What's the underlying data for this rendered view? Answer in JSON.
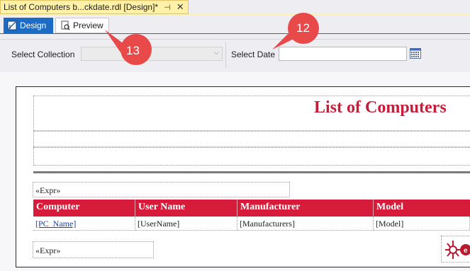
{
  "document_tab": {
    "title": "List of Computers b...ckdate.rdl [Design]*",
    "pin_icon": "pin-icon",
    "close_icon": "close-icon"
  },
  "view_tabs": {
    "design_label": "Design",
    "preview_label": "Preview"
  },
  "parameters": {
    "collection_label": "Select Collection",
    "collection_value": "",
    "date_label": "Select Date",
    "date_value": ""
  },
  "report": {
    "title": "List of Computers",
    "expr_top": "«Expr»",
    "expr_bottom": "«Expr»",
    "columns": [
      "Computer",
      "User Name",
      "Manufacturer",
      "Model"
    ],
    "row": [
      "[PC_Name]",
      "[UserName]",
      "[Manufacturers]",
      "[Model]"
    ]
  },
  "callouts": {
    "c12": "12",
    "c13": "13"
  },
  "colors": {
    "accent_blue": "#1c6bc4",
    "report_red": "#d71b3a",
    "title_red": "#c41e3a",
    "callout_red": "#e84a4a",
    "tab_yellow": "#fff1a8"
  }
}
